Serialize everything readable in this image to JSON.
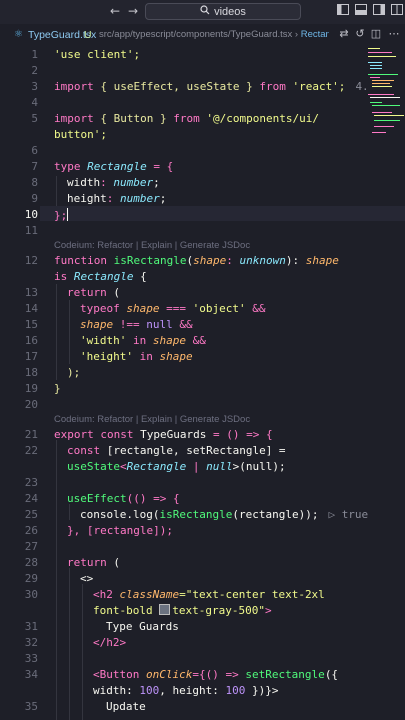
{
  "titlebar": {
    "search_text": "videos"
  },
  "tab": {
    "filename": "TypeGuard.tsx",
    "status": "U"
  },
  "breadcrumb": {
    "path": "src/app/typescript/components/TypeGuard.tsx",
    "tail": "Rectangle"
  },
  "codelens": {
    "first": "Codeium: Refactor | Explain | Generate JSDoc",
    "second": "Codeium: Refactor | Explain | Generate JSDoc"
  },
  "inlay": {
    "is_rect_hint": "true",
    "import_hint": "4."
  },
  "lines": [
    {
      "n": "1"
    },
    {
      "n": "2"
    },
    {
      "n": "3"
    },
    {
      "n": "4"
    },
    {
      "n": "5"
    },
    {
      "n": "6"
    },
    {
      "n": "7"
    },
    {
      "n": "8"
    },
    {
      "n": "9"
    },
    {
      "n": "10"
    },
    {
      "n": "11"
    },
    {
      "n": "12"
    },
    {
      "n": "13"
    },
    {
      "n": "14"
    },
    {
      "n": "15"
    },
    {
      "n": "16"
    },
    {
      "n": "17"
    },
    {
      "n": "18"
    },
    {
      "n": "19"
    },
    {
      "n": "20"
    },
    {
      "n": "21"
    },
    {
      "n": "22"
    },
    {
      "n": "23"
    },
    {
      "n": "24"
    },
    {
      "n": "25"
    },
    {
      "n": "26"
    },
    {
      "n": "27"
    },
    {
      "n": "28"
    },
    {
      "n": "29"
    },
    {
      "n": "30"
    },
    {
      "n": "31"
    },
    {
      "n": "32"
    },
    {
      "n": "33"
    },
    {
      "n": "34"
    },
    {
      "n": "35"
    }
  ],
  "code": {
    "l1": "'use client';",
    "l3_a": "import",
    "l3_b": " { useEffect, useState } ",
    "l3_c": "from",
    "l3_d": " 'react';",
    "l5_a": "import",
    "l5_b": " { Button } ",
    "l5_c": "from",
    "l5_d": " '@/components/ui/",
    "l5_e": "button';",
    "l7_a": "type",
    "l7_b": "Rectangle",
    "l7_c": " = {",
    "l8_a": "width",
    "l8_b": ": ",
    "l8_c": "number",
    "l8_d": ";",
    "l9_a": "height",
    "l9_b": ": ",
    "l9_c": "number",
    "l9_d": ";",
    "l10": "};",
    "l12_a": "function",
    "l12_b": "isRectangle",
    "l12_c": "(",
    "l12_d": "shape",
    "l12_e": ": ",
    "l12_f": "unknown",
    "l12_g": "): ",
    "l12_h": "shape",
    "l12i_a": "is",
    "l12i_b": "Rectangle",
    "l12i_c": " {",
    "l13_a": "return",
    "l13_b": " (",
    "l14_a": "typeof",
    "l14_b": "shape",
    "l14_c": " === ",
    "l14_d": "'object'",
    "l14_e": " &&",
    "l15_a": "shape",
    "l15_b": " !== ",
    "l15_c": "null",
    "l15_d": " &&",
    "l16_a": "'width'",
    "l16_b": " in ",
    "l16_c": "shape",
    "l16_d": " &&",
    "l17_a": "'height'",
    "l17_b": " in ",
    "l17_c": "shape",
    "l18": ");",
    "l19": "}",
    "l21_a": "export",
    "l21_b": "const",
    "l21_c": "TypeGuards",
    "l21_d": " = () => {",
    "l22_a": "const",
    "l22_b": " [rectangle, setRectangle] =",
    "l22i_a": "useState",
    "l22i_b": "<",
    "l22i_c": "Rectangle",
    "l22i_d": " | ",
    "l22i_e": "null",
    "l22i_f": ">(null);",
    "l24_a": "useEffect",
    "l24_b": "(() => {",
    "l25_a": "console",
    "l25_b": ".log(",
    "l25_c": "isRectangle",
    "l25_d": "(rectangle));",
    "l26": "}, [rectangle]);",
    "l28_a": "return",
    "l28_b": " (",
    "l29": "<>",
    "l30_a": "<h2",
    "l30_b": "className",
    "l30_c": "=\"text-center text-2xl",
    "l30i_a": "font-bold ",
    "l30i_b": "text-gray-500\"",
    "l30i_c": ">",
    "l31": "Type Guards",
    "l32": "</h2>",
    "l34_a": "<Button",
    "l34_b": "onClick",
    "l34_c": "={() => ",
    "l34_d": "setRectangle",
    "l34_e": "({",
    "l34i_a": "width: ",
    "l34i_b": "100",
    "l34i_c": ", height: ",
    "l34i_d": "100",
    "l34i_e": " })}>",
    "l35": "Update"
  },
  "colors": {
    "keyword": "#ff79c6",
    "function": "#50fa7b",
    "string": "#f1fa8c",
    "type": "#8be9fd",
    "param": "#ffb86c",
    "background": "#1e1f28"
  }
}
